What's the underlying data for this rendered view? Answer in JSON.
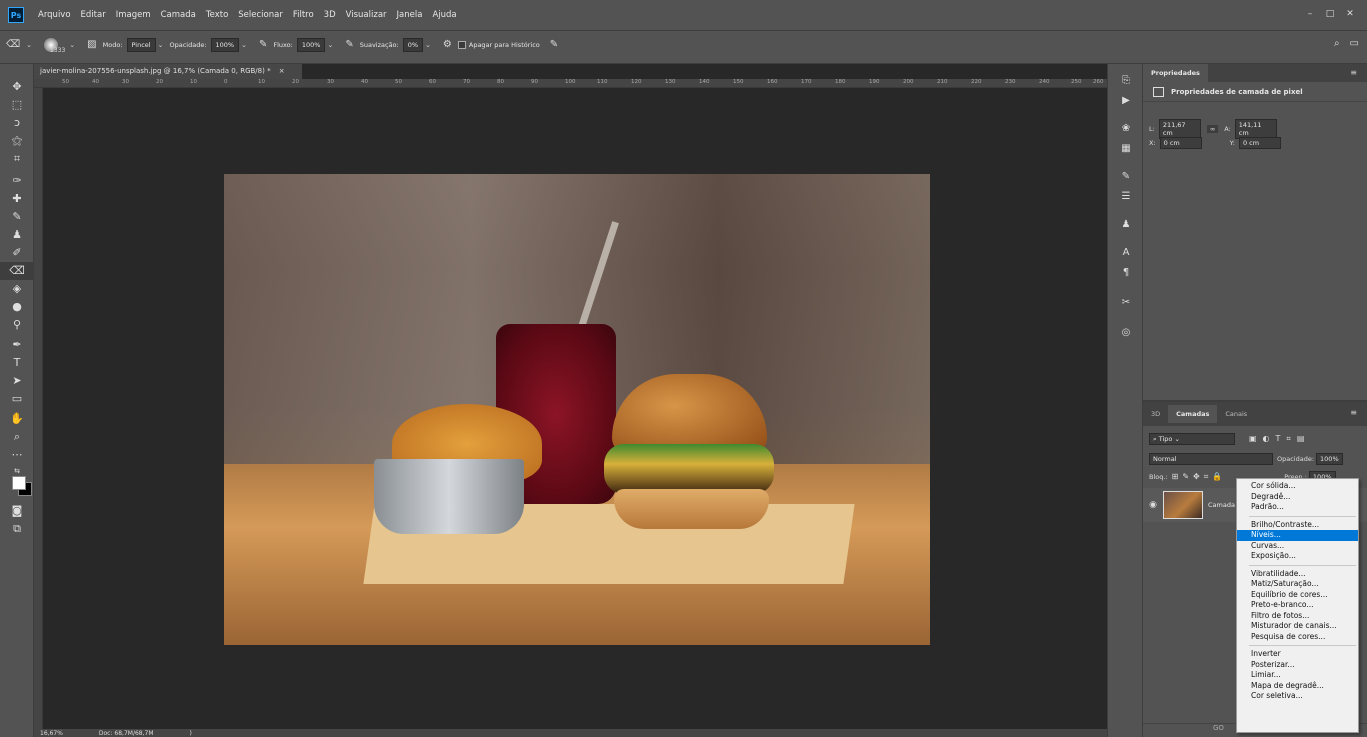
{
  "app": {
    "logo": "Ps",
    "menu": [
      "Arquivo",
      "Editar",
      "Imagem",
      "Camada",
      "Texto",
      "Selecionar",
      "Filtro",
      "3D",
      "Visualizar",
      "Janela",
      "Ajuda"
    ],
    "window_controls": [
      "–",
      "□",
      "✕"
    ]
  },
  "options": {
    "brush_size": "1333",
    "mode_label": "Modo:",
    "mode_value": "Pincel",
    "opacity_label": "Opacidade:",
    "opacity_value": "100%",
    "flow_label": "Fluxo:",
    "flow_value": "100%",
    "smoothing_label": "Suavização:",
    "smoothing_value": "0%",
    "erase_history_label": "Apagar para Histórico"
  },
  "document": {
    "tab_title": "javier-molina-207556-unsplash.jpg @ 16,7% (Camada 0, RGB/8) *",
    "tab_close": "×",
    "ruler_labels": [
      "50",
      "40",
      "30",
      "20",
      "10",
      "0",
      "10",
      "20",
      "30",
      "40",
      "50",
      "60",
      "70",
      "80",
      "90",
      "100",
      "110",
      "120",
      "130",
      "140",
      "150",
      "160",
      "170",
      "180",
      "190",
      "200",
      "210",
      "220",
      "230",
      "240",
      "250",
      "260"
    ],
    "zoom": "16,67%",
    "doc_info": "Doc: 68,7M/68,7M",
    "status_arrow": ")"
  },
  "properties": {
    "tab": "Propriedades",
    "section_title": "Propriedades de camada de pixel",
    "w_label": "L:",
    "w_value": "211,67 cm",
    "h_label": "A:",
    "h_value": "141,11 cm",
    "x_label": "X:",
    "x_value": "0 cm",
    "y_label": "Y:",
    "y_value": "0 cm"
  },
  "layers": {
    "tabs": [
      "3D",
      "Camadas",
      "Canais"
    ],
    "filter_label": "Tipo",
    "blend_mode": "Normal",
    "opacity_label": "Opacidade:",
    "opacity_value": "100%",
    "lock_label": "Bloq.:",
    "fill_label": "Preen.:",
    "fill_value": "100%",
    "layer_name": "Camada 0",
    "footer_icons": "GO"
  },
  "context_menu": {
    "groups": [
      [
        "Cor sólida...",
        "Degradê...",
        "Padrão..."
      ],
      [
        "Brilho/Contraste...",
        "Níveis...",
        "Curvas...",
        "Exposição..."
      ],
      [
        "Vibratilidade...",
        "Matiz/Saturação...",
        "Equilíbrio de cores...",
        "Preto-e-branco...",
        "Filtro de fotos...",
        "Misturador de canais...",
        "Pesquisa de cores..."
      ],
      [
        "Inverter",
        "Posterizar...",
        "Limiar...",
        "Mapa de degradê...",
        "Cor seletiva..."
      ]
    ],
    "highlighted": "Níveis..."
  },
  "colors": {
    "accent": "#0078d7",
    "panel_bg": "#535353",
    "canvas_bg": "#282828"
  }
}
